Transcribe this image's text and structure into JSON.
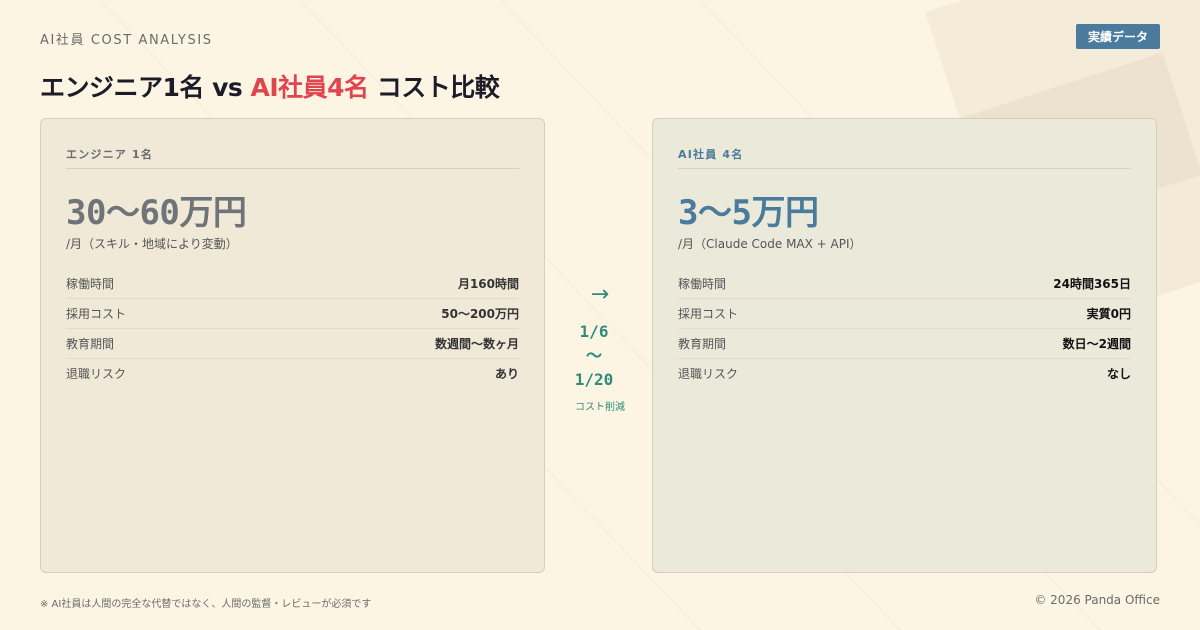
{
  "header": {
    "kicker": "AI社員 COST ANALYSIS",
    "badge": "実績データ",
    "title_part1": "エンジニア1名 vs ",
    "title_accent": "AI社員4名",
    "title_part2": " コスト比較"
  },
  "left_card": {
    "label": "エンジニア 1名",
    "price": "30〜60万円",
    "note": "/月（スキル・地域により変動）",
    "rows": [
      {
        "key": "稼働時間",
        "value": "月160時間"
      },
      {
        "key": "採用コスト",
        "value": "50〜200万円"
      },
      {
        "key": "教育期間",
        "value": "数週間〜数ヶ月"
      },
      {
        "key": "退職リスク",
        "value": "あり"
      }
    ]
  },
  "right_card": {
    "label": "AI社員 4名",
    "price": "3〜5万円",
    "note": "/月（Claude Code MAX + API）",
    "rows": [
      {
        "key": "稼働時間",
        "value": "24時間365日"
      },
      {
        "key": "採用コスト",
        "value": "実質0円"
      },
      {
        "key": "教育期間",
        "value": "数日〜2週間"
      },
      {
        "key": "退職リスク",
        "value": "なし"
      }
    ]
  },
  "middle": {
    "arrow": "→",
    "ratio_top": "1/6",
    "ratio_sep": "〜",
    "ratio_bottom": "1/20",
    "ratio_label": "コスト削減"
  },
  "footer": {
    "note": "※ AI社員は人間の完全な代替ではなく、人間の監督・レビューが必須です",
    "copyright": "© 2026 Panda Office"
  },
  "colors": {
    "background": "#fcf5e4",
    "accent_red": "#e0444c",
    "accent_blue": "#4a7a9c",
    "accent_green": "#2f8c78"
  }
}
